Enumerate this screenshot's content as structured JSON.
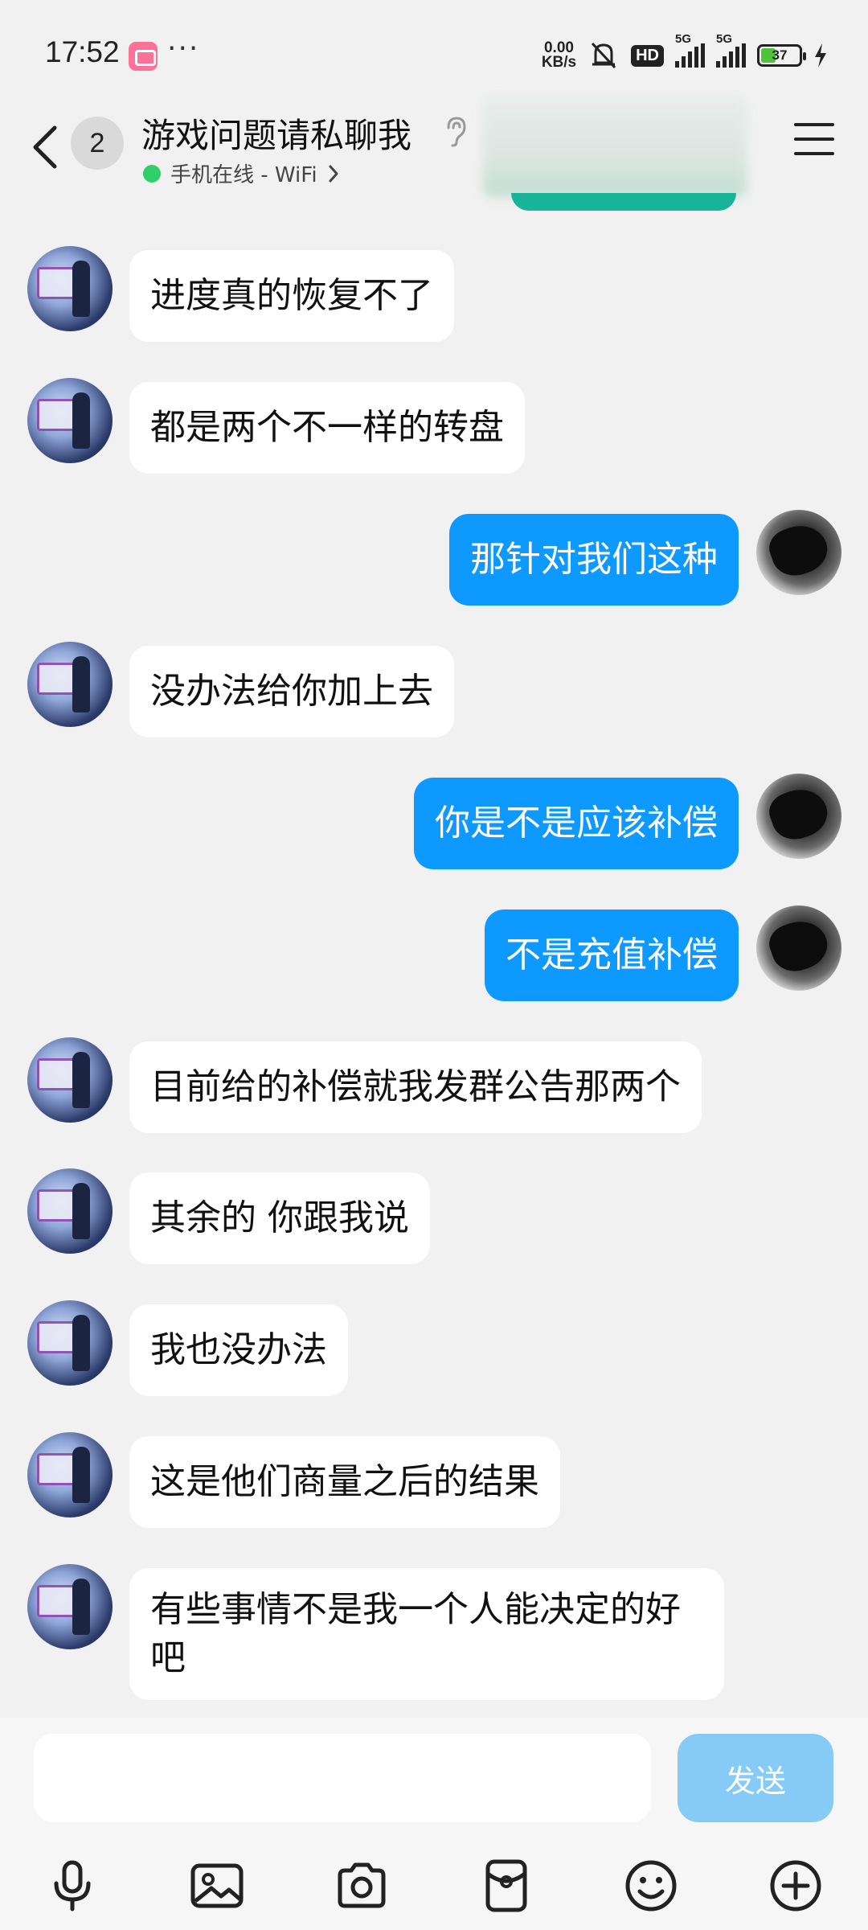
{
  "status_bar": {
    "time": "17:52",
    "more": "···",
    "net_speed_value": "0.00",
    "net_speed_unit": "KB/s",
    "hd_label": "HD",
    "signal_1_label": "5G",
    "signal_2_label": "5G",
    "battery_level": "37",
    "battery_fill_fraction": 0.37
  },
  "header": {
    "unread_count": "2",
    "title": "游戏问题请私聊我",
    "online_status": "手机在线 - WiFi"
  },
  "messages": [
    {
      "sender": "them",
      "text": "进度真的恢复不了"
    },
    {
      "sender": "them",
      "text": "都是两个不一样的转盘"
    },
    {
      "sender": "me",
      "text": "那针对我们这种"
    },
    {
      "sender": "them",
      "text": "没办法给你加上去"
    },
    {
      "sender": "me",
      "text": "你是不是应该补偿"
    },
    {
      "sender": "me",
      "text": "不是充值补偿"
    },
    {
      "sender": "them",
      "text": "目前给的补偿就我发群公告那两个"
    },
    {
      "sender": "them",
      "text": "其余的 你跟我说"
    },
    {
      "sender": "them",
      "text": "我也没办法"
    },
    {
      "sender": "them",
      "text": "这是他们商量之后的结果"
    },
    {
      "sender": "them",
      "text": "有些事情不是我一个人能决定的好吧"
    }
  ],
  "input": {
    "value": "",
    "placeholder": "",
    "send_label": "发送"
  },
  "toolbar": {
    "icons": [
      "microphone-icon",
      "image-icon",
      "camera-icon",
      "red-packet-icon",
      "emoji-icon",
      "plus-icon"
    ]
  },
  "colors": {
    "my_bubble": "#0d99ff",
    "their_bubble": "#ffffff",
    "background": "#f1f1f1",
    "send_button_disabled": "#86cbf6",
    "online_dot": "#2fcf6a"
  }
}
